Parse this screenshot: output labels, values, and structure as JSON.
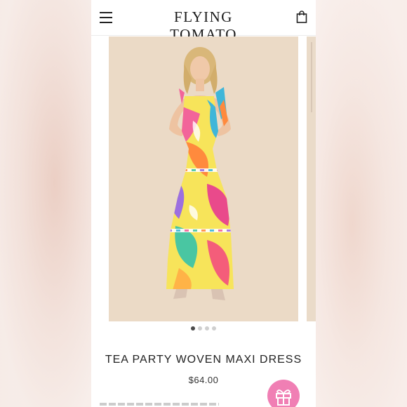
{
  "header": {
    "brand": "FLYING TOMATO",
    "menu_icon": "hamburger-menu-icon",
    "cart_icon": "shopping-bag-icon"
  },
  "gallery": {
    "image_count": 4,
    "active_index": 0
  },
  "product": {
    "title": "TEA PARTY WOVEN MAXI DRESS",
    "price": "$64.00"
  },
  "floating": {
    "gift_icon": "gift-icon",
    "accent": "#f07fb4"
  },
  "colors": {
    "image_bg": "#e8d6c1"
  }
}
